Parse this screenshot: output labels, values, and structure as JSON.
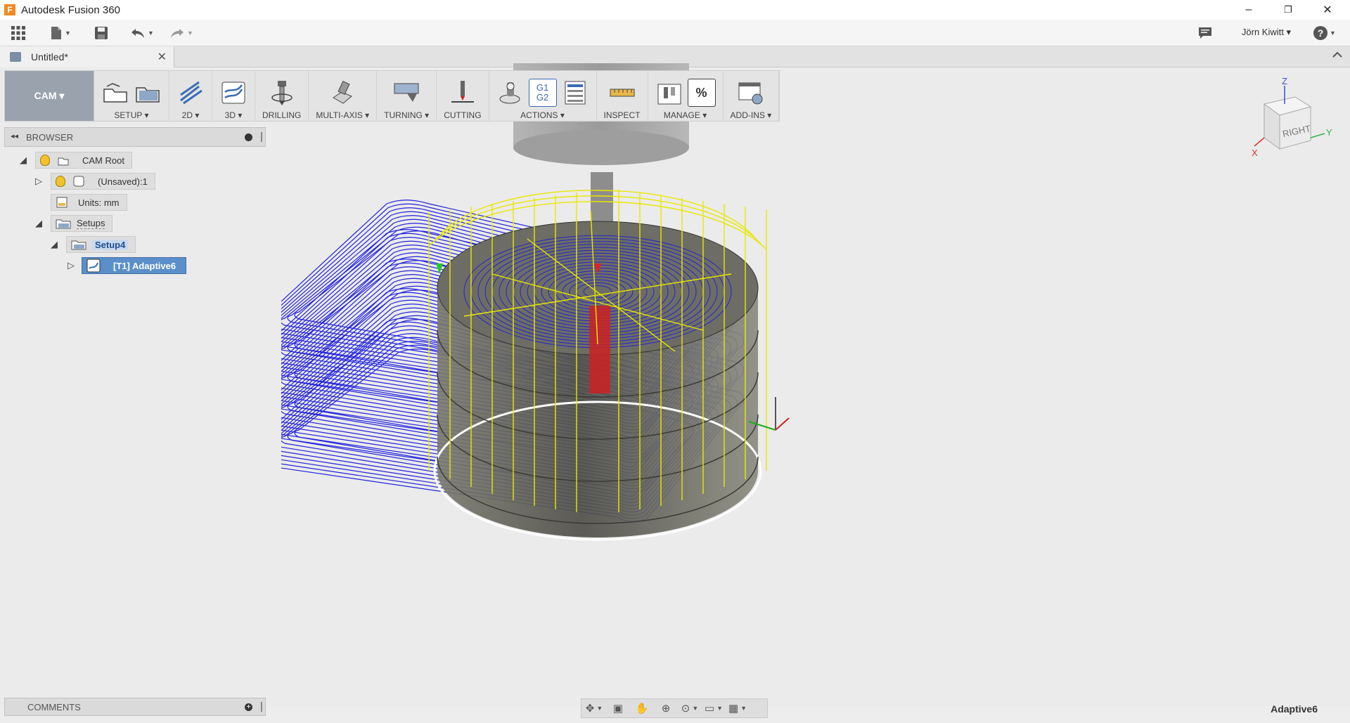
{
  "window": {
    "title": "Autodesk Fusion 360",
    "logo_letter": "F",
    "minimize": "–",
    "restore": "❐",
    "close": "✕"
  },
  "quick_access": {
    "user": "Jörn Kiwitt ▾",
    "help": "?"
  },
  "document_tab": {
    "label": "Untitled*",
    "close": "✕"
  },
  "workspace": {
    "label": "CAM ▾"
  },
  "toolbar": {
    "groups": [
      {
        "label": "SETUP ▾"
      },
      {
        "label": "2D ▾"
      },
      {
        "label": "3D ▾"
      },
      {
        "label": "DRILLING"
      },
      {
        "label": "MULTI-AXIS ▾"
      },
      {
        "label": "TURNING ▾"
      },
      {
        "label": "CUTTING"
      },
      {
        "label": "ACTIONS ▾"
      },
      {
        "label": "INSPECT"
      },
      {
        "label": "MANAGE ▾"
      },
      {
        "label": "ADD-INS ▾"
      }
    ],
    "g1g2_text_1": "G1",
    "g1g2_text_2": "G2",
    "percent_text": "%"
  },
  "browser": {
    "title": "BROWSER",
    "items": [
      {
        "label": "CAM Root"
      },
      {
        "label": "(Unsaved):1"
      },
      {
        "label": "Units: mm"
      },
      {
        "label": "Setups"
      },
      {
        "label": "Setup4"
      },
      {
        "label": "[T1] Adaptive6"
      }
    ]
  },
  "comments": {
    "title": "COMMENTS"
  },
  "viewcube": {
    "face_label": "RIGHT",
    "axis_z": "Z",
    "axis_y": "Y",
    "axis_x": "X"
  },
  "status": {
    "operation": "Adaptive6"
  },
  "colors": {
    "toolpath_blue": "#2222dd",
    "rapid_yellow": "#ffff00",
    "selection_blue": "#5b8fc9",
    "workspace_gray": "#9aa3ad"
  }
}
